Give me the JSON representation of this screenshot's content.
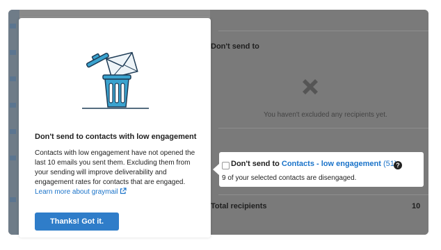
{
  "background": {
    "section_title": "Don't send to",
    "empty_message": "You haven't excluded any recipients yet.",
    "total_label": "Total recipients",
    "total_value": "10"
  },
  "callout": {
    "prefix": "Don't send to ",
    "link_text": "Contacts - low engagement",
    "count": "(51)",
    "help_glyph": "?",
    "message": "9 of your selected contacts are disengaged."
  },
  "modal": {
    "title": "Don't send to contacts with low engagement",
    "body": "Contacts with low engagement have not opened the last 10 emails you sent them. Excluding them from your sending will improve deliverability and engagement rates for contacts that are engaged.",
    "learn_more": "Learn more about graymail",
    "button_label": "Thanks! Got it."
  },
  "icons": {
    "illustration": "trash-can-with-envelope-icon",
    "empty_state": "x-icon",
    "external_link": "external-link-icon",
    "help": "help-icon"
  },
  "colors": {
    "accent_blue": "#1a73c9",
    "button_blue": "#2f7dc9",
    "illustration_blue": "#3aa3cf",
    "overlay_gray": "#7d7d7d"
  }
}
